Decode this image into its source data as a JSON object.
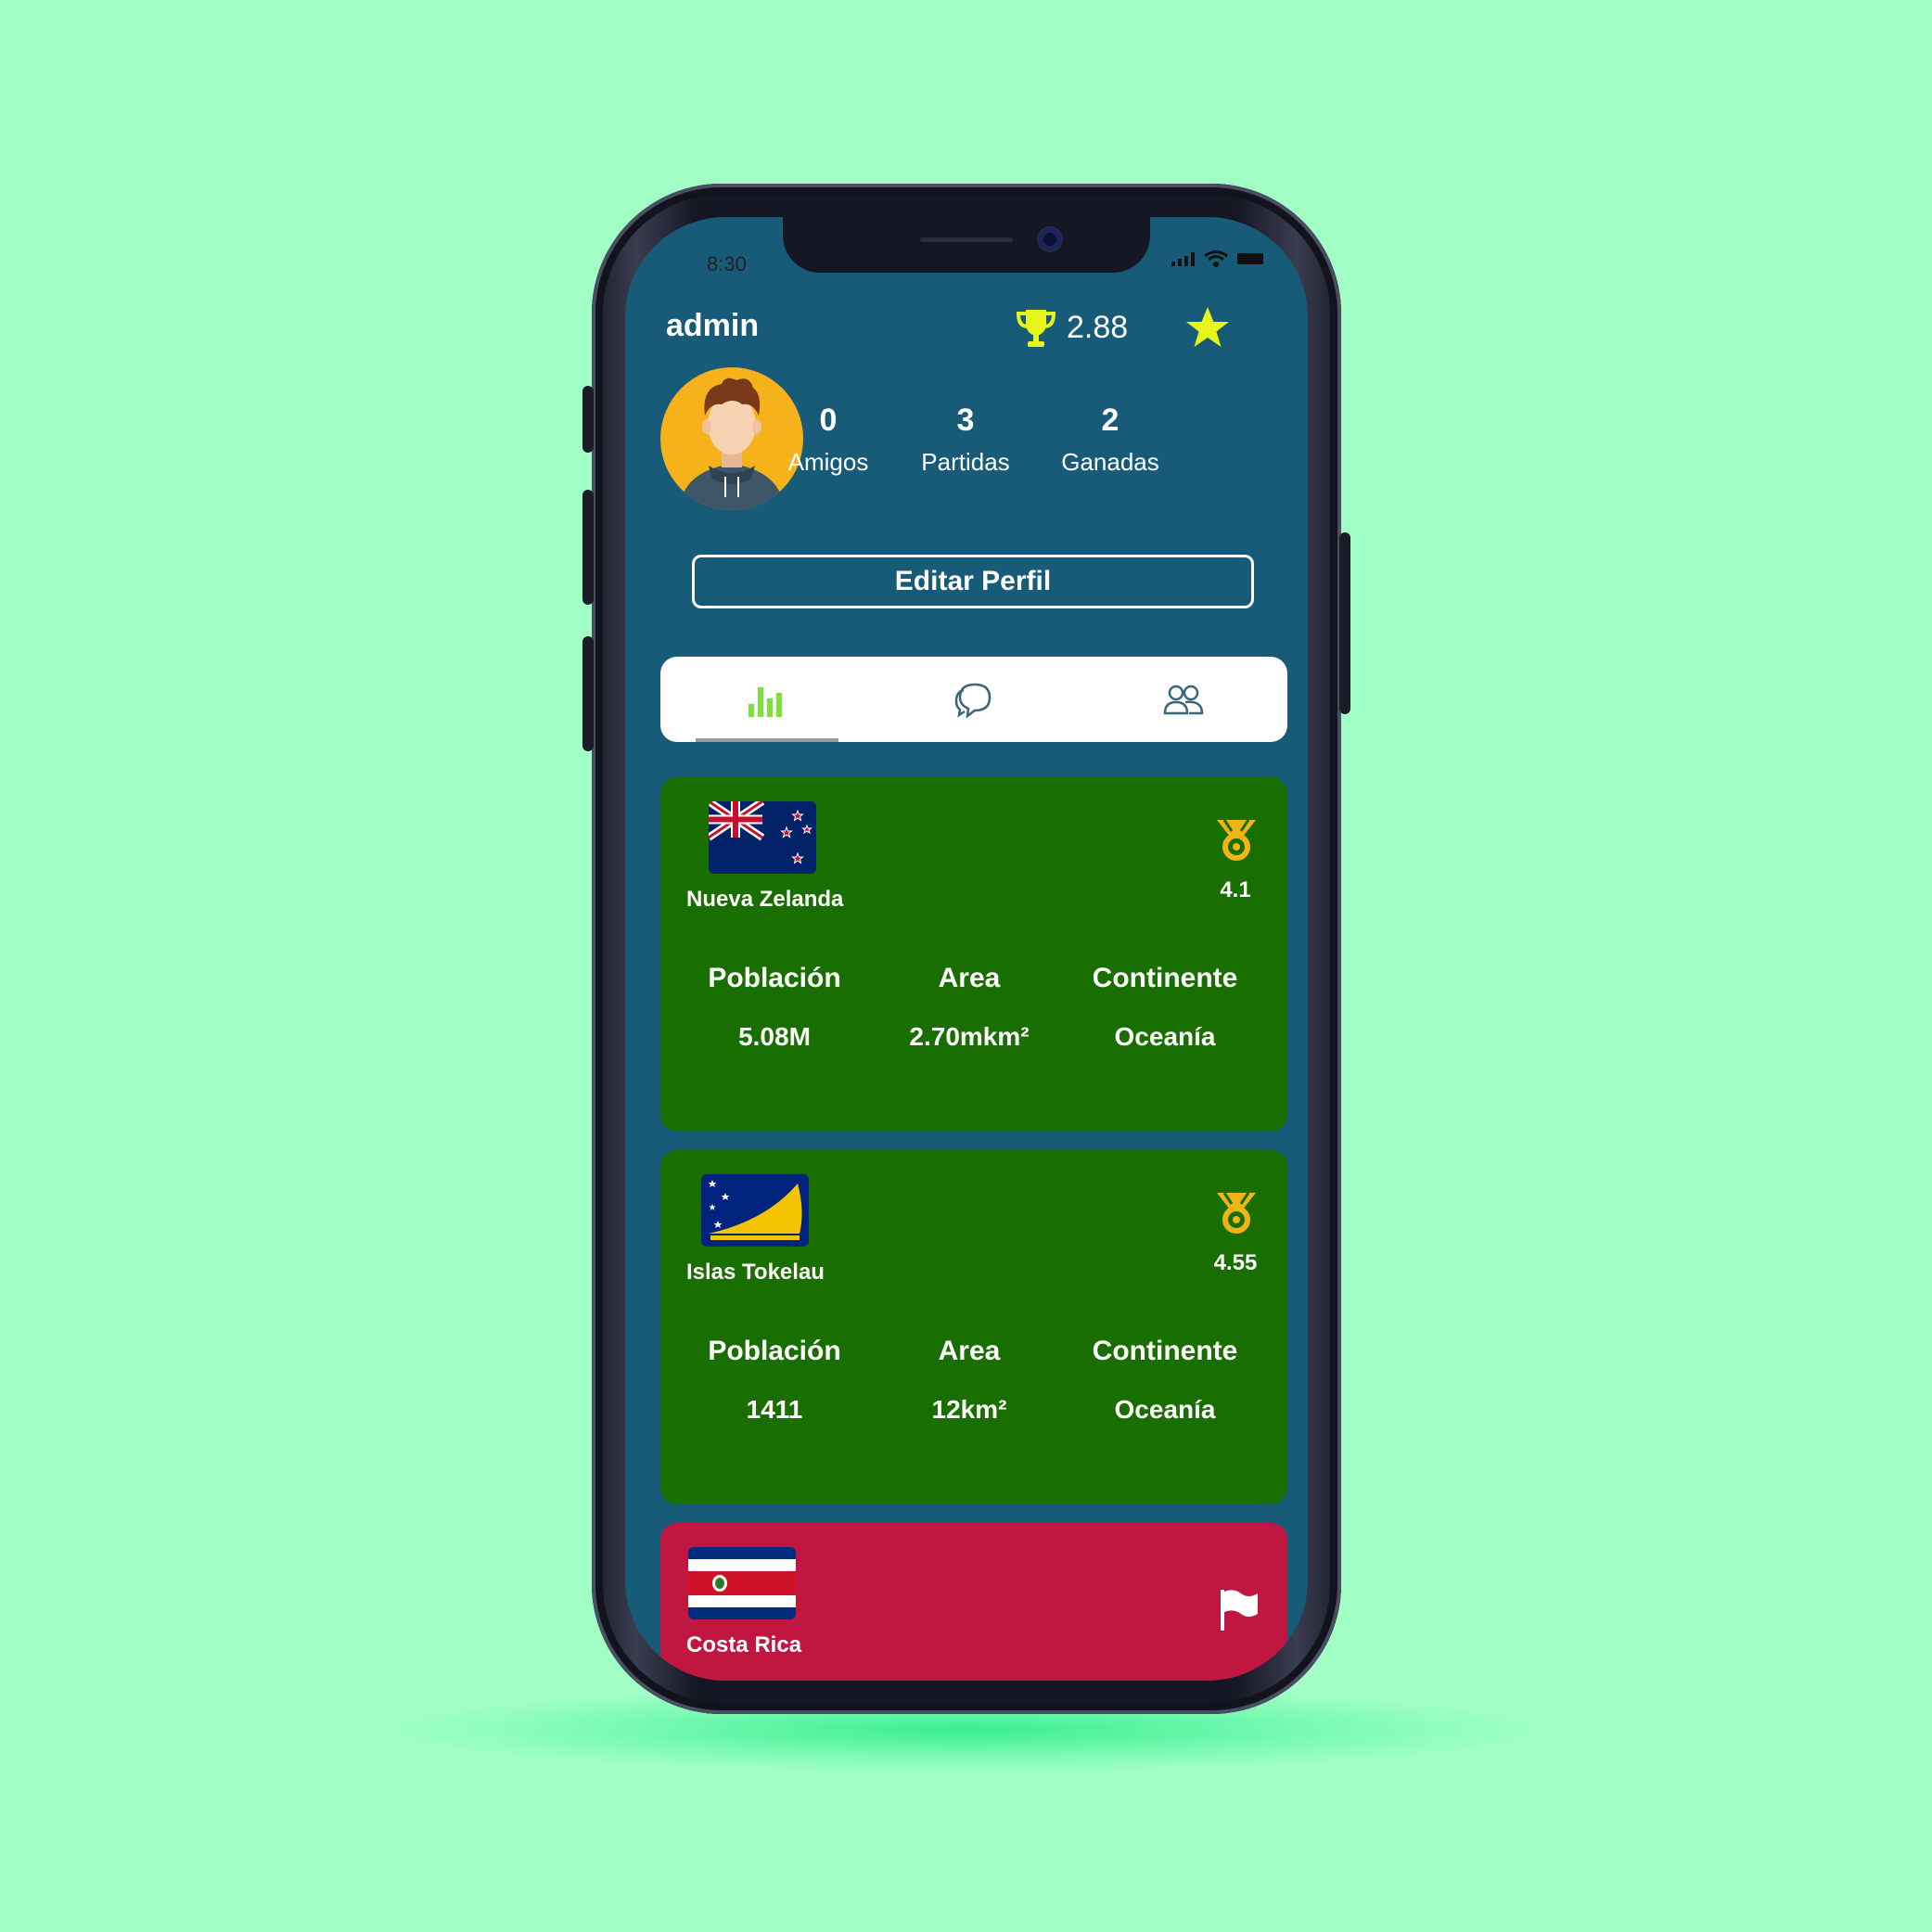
{
  "status_bar": {
    "time": "8:30"
  },
  "header": {
    "username": "admin",
    "score": "2.88",
    "icons": [
      "trophy-icon",
      "star-icon"
    ]
  },
  "profile": {
    "stats": [
      {
        "value": "0",
        "label": "Amigos"
      },
      {
        "value": "3",
        "label": "Partidas"
      },
      {
        "value": "2",
        "label": "Ganadas"
      }
    ],
    "edit_button": "Editar Perfil"
  },
  "tabs": [
    {
      "icon": "bar-chart-icon",
      "active": true
    },
    {
      "icon": "chat-bubbles-icon",
      "active": false
    },
    {
      "icon": "users-icon",
      "active": false
    }
  ],
  "cards": [
    {
      "name": "Nueva Zelanda",
      "rating": "4.1",
      "status": "medal-icon",
      "labels": [
        "Población",
        "Area",
        "Continente"
      ],
      "values": [
        "5.08M",
        "2.70mkm²",
        "Oceanía"
      ]
    },
    {
      "name": "Islas Tokelau",
      "rating": "4.55",
      "status": "medal-icon",
      "labels": [
        "Población",
        "Area",
        "Continente"
      ],
      "values": [
        "1411",
        "12km²",
        "Oceanía"
      ]
    },
    {
      "name": "Costa Rica",
      "status": "flag-icon"
    }
  ],
  "colors": {
    "background": "#a1ffc6",
    "screen": "#175b78",
    "card_green": "#196e00",
    "card_red": "#c0163f",
    "accent_yellow": "#e6f51a",
    "medal": "#f0b416"
  }
}
